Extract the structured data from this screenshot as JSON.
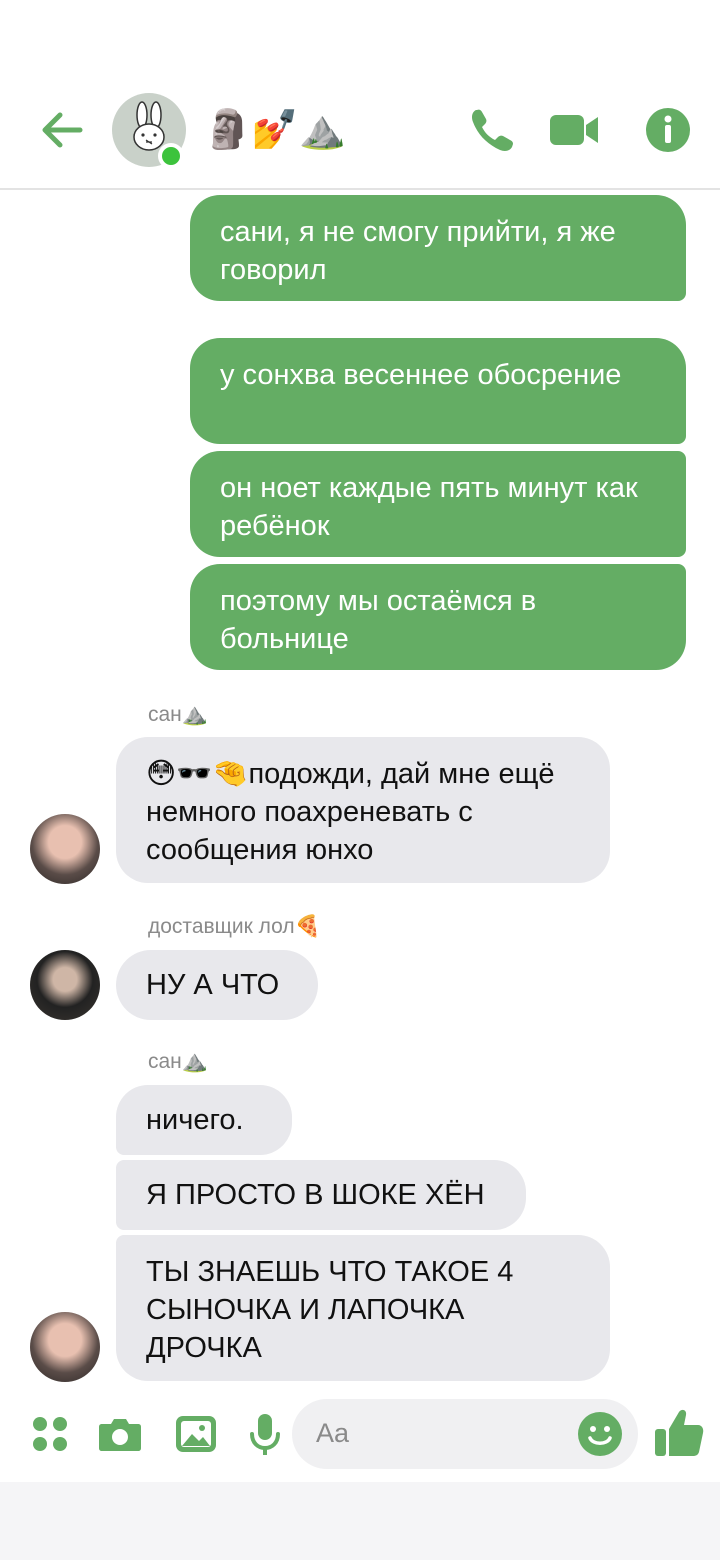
{
  "chat": {
    "title": "🗿💅⛰️",
    "accent_color": "#64ad64",
    "online_color": "#3cc33c"
  },
  "messages": {
    "m1": "сани, я не смогу прийти, я же говорил",
    "m2": "у сонхва весеннее обосрение",
    "m3": "он ноет каждые пять минут как ребёнок",
    "m4": "поэтому мы остаёмся в больнице",
    "s1": "сан⛰️",
    "m5": "😳🕶️🤏подожди, дай мне ещё немного поахреневать с сообщения юнхо",
    "s2": "доставщик лол🍕",
    "m6": "НУ А ЧТО",
    "s3": "сан⛰️",
    "m7": "ничего.",
    "m8": "Я ПРОСТО В ШОКЕ ХЁН",
    "m9": "ТЫ ЗНАЕШЬ ЧТО ТАКОЕ 4 СЫНОЧКА И ЛАПОЧКА ДРОЧКА"
  },
  "composer": {
    "placeholder": "Aa"
  }
}
